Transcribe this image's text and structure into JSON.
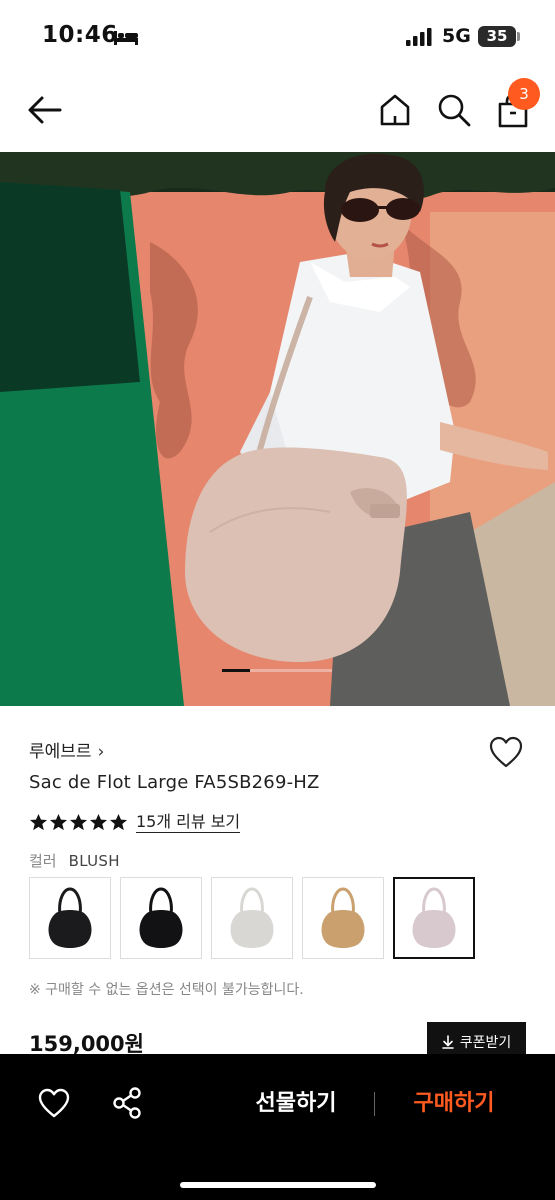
{
  "status_bar": {
    "time": "10:46",
    "network": "5G",
    "battery": "35"
  },
  "header": {
    "cart_count": "3",
    "icons": [
      "back-arrow-icon",
      "home-icon",
      "search-icon",
      "shopping-bag-icon"
    ]
  },
  "hero": {
    "image": "woman-with-blush-shoulder-bag-photo",
    "carousel_position": 0.25
  },
  "product": {
    "brand": "루에브르",
    "brand_chevron": "›",
    "name": "Sac de Flot Large FA5SB269-HZ",
    "rating": 5,
    "review_link": "15개 리뷰 보기",
    "color_label": "컬러",
    "color_value": "BLUSH",
    "option_note": "※ 구매할 수 없는 옵션은 선택이 불가능합니다.",
    "price": "159,000원",
    "coupon_label": "쿠폰받기"
  },
  "colors": {
    "accent": "#ff5a1f",
    "swatches": [
      "#1b1b1e",
      "#121215",
      "#d9d7d4",
      "#c9a06e",
      "#d8c9cf"
    ],
    "selected_swatch": 4
  },
  "bottom_bar": {
    "gift_label": "선물하기",
    "buy_label": "구매하기"
  }
}
